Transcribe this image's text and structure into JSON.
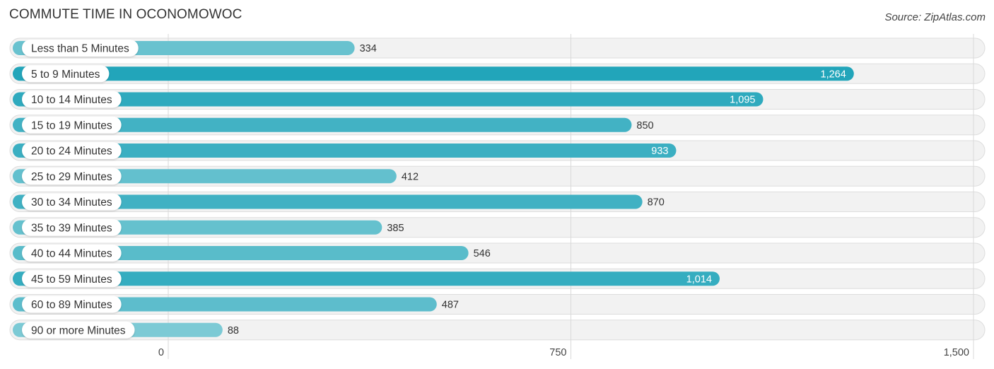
{
  "header": {
    "title": "COMMUTE TIME IN OCONOMOWOC",
    "source": "Source: ZipAtlas.com"
  },
  "colors": {
    "bar_strong": "#22a5ba",
    "bar_light": "#7ccad5",
    "track": "#f2f2f2",
    "track_border": "#dddddd",
    "grid": "#d9d9d9"
  },
  "chart_data": {
    "type": "bar",
    "orientation": "horizontal",
    "title": "COMMUTE TIME IN OCONOMOWOC",
    "xlabel": "",
    "ylabel": "",
    "categories": [
      "Less than 5 Minutes",
      "5 to 9 Minutes",
      "10 to 14 Minutes",
      "15 to 19 Minutes",
      "20 to 24 Minutes",
      "25 to 29 Minutes",
      "30 to 34 Minutes",
      "35 to 39 Minutes",
      "40 to 44 Minutes",
      "45 to 59 Minutes",
      "60 to 89 Minutes",
      "90 or more Minutes"
    ],
    "values": [
      334,
      1264,
      1095,
      850,
      933,
      412,
      870,
      385,
      546,
      1014,
      487,
      88
    ],
    "value_labels": [
      "334",
      "1,264",
      "1,095",
      "850",
      "933",
      "412",
      "870",
      "385",
      "546",
      "1,014",
      "487",
      "88"
    ],
    "xlim": [
      0,
      1500
    ],
    "xticks": [
      0,
      750,
      1500
    ],
    "xtick_labels": [
      "0",
      "750",
      "1,500"
    ],
    "grid": true,
    "legend": "none"
  }
}
